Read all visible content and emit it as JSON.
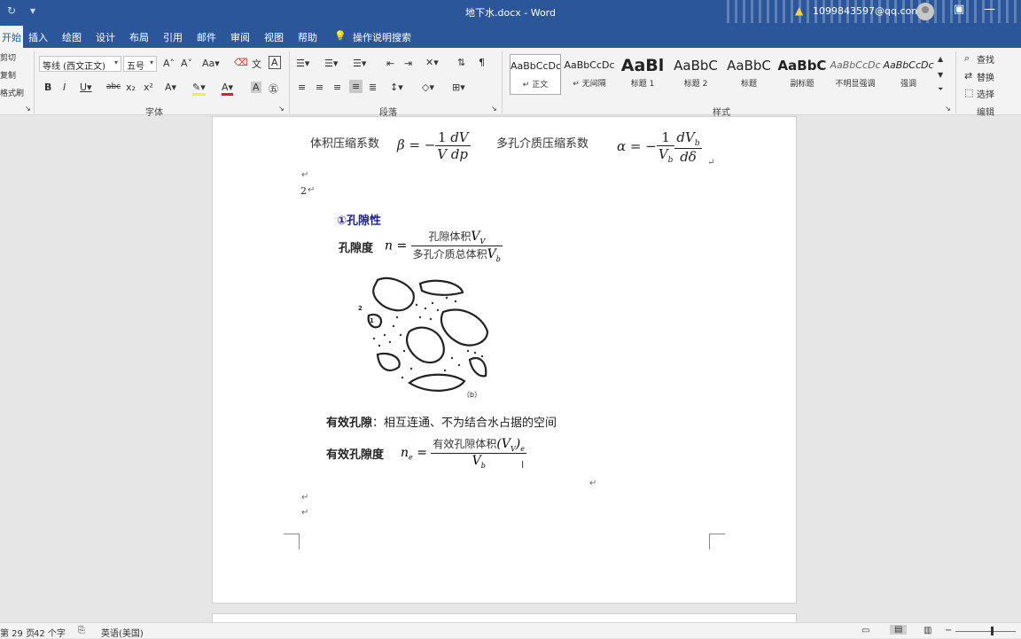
{
  "titlebar": {
    "title": "地下水.docx - Word",
    "account": "1099843597@qq.com"
  },
  "tabs": [
    "开始",
    "插入",
    "绘图",
    "设计",
    "布局",
    "引用",
    "邮件",
    "审阅",
    "视图",
    "帮助",
    "操作说明搜索"
  ],
  "ribbon": {
    "clipboard": {
      "cut": "剪切",
      "copy": "复制",
      "format_painter": "格式刷"
    },
    "font": {
      "name": "等线 (西文正文)",
      "size": "五号",
      "group_label": "字体"
    },
    "paragraph": {
      "group_label": "段落"
    },
    "styles": {
      "group_label": "样式",
      "items": [
        {
          "sample": "AaBbCcDc",
          "name": "↵ 正文"
        },
        {
          "sample": "AaBbCcDc",
          "name": "↵ 无间隔"
        },
        {
          "sample": "AaBl",
          "name": "标题 1"
        },
        {
          "sample": "AaBbC",
          "name": "标题 2"
        },
        {
          "sample": "AaBbC",
          "name": "标题"
        },
        {
          "sample": "AaBbC",
          "name": "副标题"
        },
        {
          "sample": "AaBbCcDc",
          "name": "不明显强调"
        },
        {
          "sample": "AaBbCcDc",
          "name": "强调"
        }
      ]
    },
    "editing": {
      "find": "查找",
      "replace": "替换",
      "select": "选择",
      "group_label": "编辑"
    }
  },
  "document": {
    "line1_label": "体积压缩系数",
    "line1_label2": "多孔介质压缩系数",
    "list_number": "2",
    "heading": "①孔隙性",
    "porosity_label": "孔隙度",
    "porosity_num": "孔隙体积",
    "porosity_den": "多孔介质总体积",
    "figure_caption": "（b）",
    "figure_label_2": "2",
    "figure_label_1": "1",
    "effective_pore_label": "有效孔隙",
    "effective_pore_text": "：相互连通、不为结合水占据的空间",
    "effective_porosity_label": "有效孔隙度",
    "effective_num": "有效孔隙体积"
  },
  "status": {
    "page": "第 29 页",
    "words": "42 个字",
    "language": "英语(美国)"
  },
  "colors": {
    "accent": "#2b579a",
    "heading": "#1a1aa6"
  }
}
